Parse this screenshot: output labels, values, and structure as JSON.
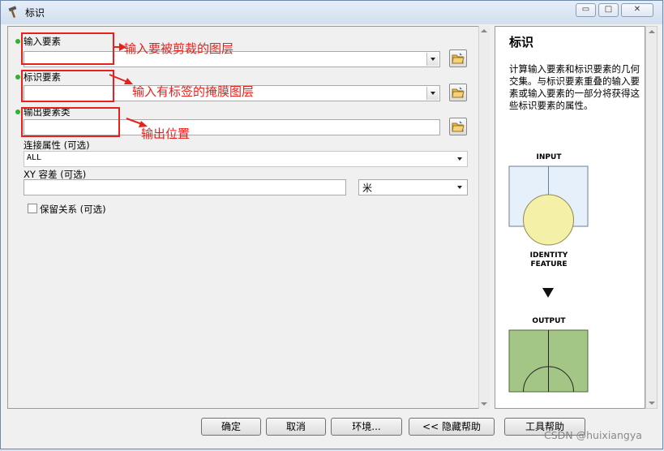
{
  "window": {
    "title": "标识",
    "min_label": "▭",
    "max_label": "□",
    "close_label": "✕"
  },
  "form": {
    "input_features": {
      "label": "输入要素",
      "value": ""
    },
    "identity_features": {
      "label": "标识要素",
      "value": ""
    },
    "output_feature_class": {
      "label": "输出要素类",
      "value": ""
    },
    "join_attributes": {
      "label": "连接属性 (可选)",
      "value": "ALL"
    },
    "xy_tolerance": {
      "label": "XY 容差 (可选)",
      "value": "",
      "unit": "米"
    },
    "keep_relationships": {
      "label": "保留关系 (可选)",
      "checked": false
    }
  },
  "annotations": {
    "input": "输入要被剪裁的图层",
    "identity": "输入有标签的掩膜图层",
    "output": "输出位置",
    "color": "#e8211c"
  },
  "help": {
    "title": "标识",
    "description": "计算输入要素和标识要素的几何交集。与标识要素重叠的输入要素或输入要素的一部分将获得这些标识要素的属性。",
    "diagram": {
      "input_caption": "INPUT",
      "identity_caption": "IDENTITY FEATURE",
      "output_caption": "OUTPUT"
    }
  },
  "buttons": {
    "ok": "确定",
    "cancel": "取消",
    "environments": "环境...",
    "hide_help": "<< 隐藏帮助",
    "tool_help": "工具帮助"
  },
  "watermark": "CSDN @huixiangya",
  "colors": {
    "required_dot": "#2fb32f",
    "input_fill": "#e6f0fa",
    "identity_fill": "#f5f0a8",
    "output_fill": "#a3c585"
  }
}
